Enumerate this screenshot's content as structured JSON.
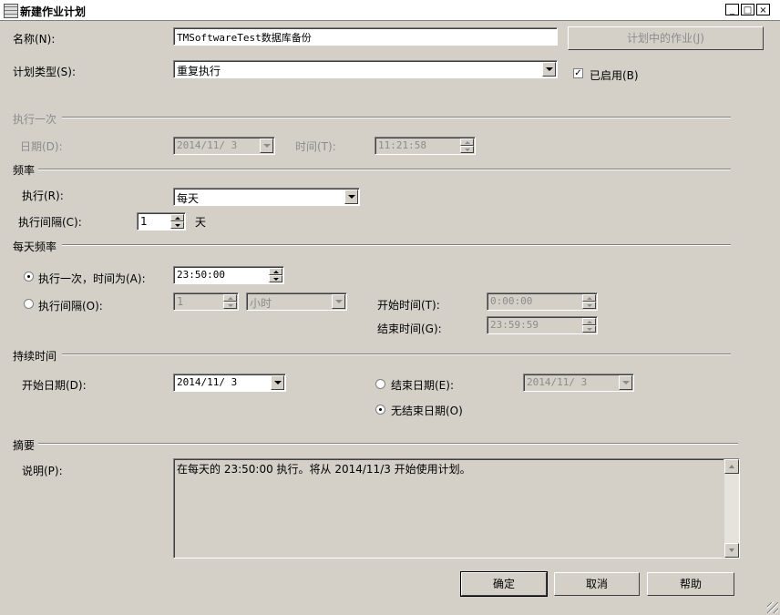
{
  "window": {
    "title": "新建作业计划"
  },
  "name": {
    "label": "名称(N):",
    "value": "TMSoftwareTest数据库备份",
    "jobs_button": "计划中的作业(J)"
  },
  "schedule_type": {
    "label": "计划类型(S):",
    "value": "重复执行",
    "enabled_label": "已启用(B)",
    "enabled": true
  },
  "once": {
    "section": "执行一次",
    "date_label": "日期(D):",
    "date_value": "2014/11/ 3",
    "time_label": "时间(T):",
    "time_value": "11:21:58"
  },
  "frequency": {
    "section": "频率",
    "occurs_label": "执行(R):",
    "occurs_value": "每天",
    "interval_label": "执行间隔(C):",
    "interval_value": "1",
    "interval_unit": "天"
  },
  "daily": {
    "section": "每天频率",
    "once_label": "执行一次，时间为(A):",
    "once_value": "23:50:00",
    "once_selected": true,
    "every_label": "执行间隔(O):",
    "every_value": "1",
    "every_unit": "小时",
    "start_label": "开始时间(T):",
    "start_value": "0:00:00",
    "end_label": "结束时间(G):",
    "end_value": "23:59:59"
  },
  "duration": {
    "section": "持续时间",
    "start_label": "开始日期(D):",
    "start_value": "2014/11/ 3",
    "end_label": "结束日期(E):",
    "end_value": "2014/11/ 3",
    "no_end_label": "无结束日期(O)",
    "no_end_selected": true
  },
  "summary": {
    "section": "摘要",
    "desc_label": "说明(P):",
    "desc_value": "在每天的 23:50:00 执行。将从 2014/11/3 开始使用计划。"
  },
  "buttons": {
    "ok": "确定",
    "cancel": "取消",
    "help": "帮助"
  },
  "colors": {
    "dialog_bg": "#d4d0c8",
    "disabled_text": "#8c8c8c"
  }
}
